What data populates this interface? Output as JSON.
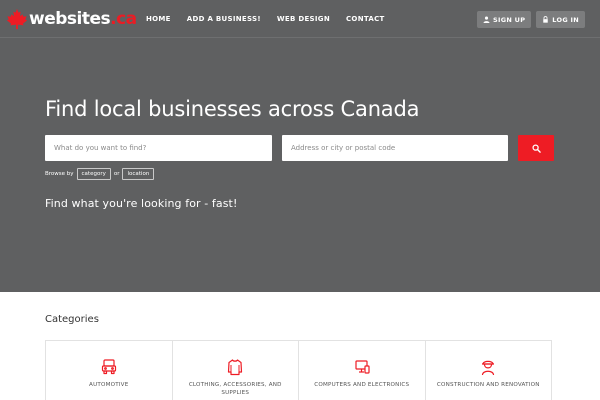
{
  "brand": {
    "logo_main": "websites",
    "logo_tld": ".ca",
    "accent_color": "#ee1c24"
  },
  "nav": {
    "items": [
      {
        "label": "HOME"
      },
      {
        "label": "ADD A BUSINESS!"
      },
      {
        "label": "WEB DESIGN"
      },
      {
        "label": "CONTACT"
      }
    ]
  },
  "auth": {
    "sign_up": "SIGN UP",
    "log_in": "LOG IN",
    "sign_up_icon": "user-icon",
    "log_in_icon": "lock-icon"
  },
  "hero": {
    "headline": "Find local businesses across Canada",
    "what_placeholder": "What do you want to find?",
    "where_placeholder": "Address or city or postal code",
    "search_icon": "search-icon",
    "browse_prefix": "Browse by",
    "browse_category": "category",
    "browse_or": "or",
    "browse_location": "location",
    "tagline": "Find what you're looking for - fast!"
  },
  "categories": {
    "title": "Categories",
    "items": [
      {
        "label": "AUTOMOTIVE",
        "icon": "car-icon"
      },
      {
        "label": "CLOTHING, ACCESSORIES, AND SUPPLIES",
        "icon": "shirt-icon"
      },
      {
        "label": "COMPUTERS AND ELECTRONICS",
        "icon": "computer-icon"
      },
      {
        "label": "CONSTRUCTION AND RENOVATION",
        "icon": "worker-icon"
      }
    ]
  }
}
